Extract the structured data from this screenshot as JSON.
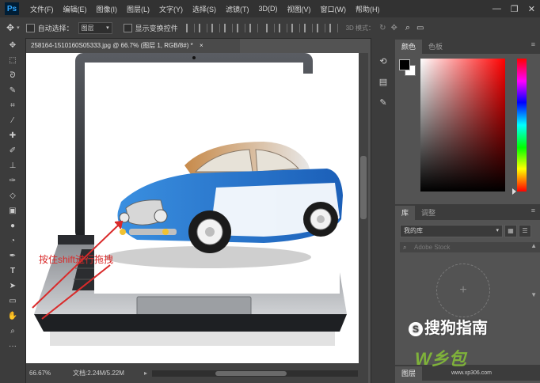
{
  "app": {
    "logo_text": "Ps",
    "menu": [
      "文件(F)",
      "编辑(E)",
      "图像(I)",
      "图层(L)",
      "文字(Y)",
      "选择(S)",
      "滤镜(T)",
      "3D(D)",
      "视图(V)",
      "窗口(W)",
      "帮助(H)"
    ],
    "window_controls": {
      "minimize": "—",
      "restore": "❐",
      "close": "✕"
    }
  },
  "options_bar": {
    "move_tool_icon": "move-icon",
    "auto_select_label": "自动选择：",
    "auto_select_checked": false,
    "auto_select_value": "图层",
    "show_transform_label": "显示变换控件",
    "show_transform_checked": false,
    "mode_3d_label": "3D 模式："
  },
  "tools": [
    "move-tool",
    "marquee-tool",
    "lasso-tool",
    "quick-select-tool",
    "crop-tool",
    "eyedropper-tool",
    "healing-brush-tool",
    "brush-tool",
    "clone-stamp-tool",
    "history-brush-tool",
    "eraser-tool",
    "gradient-tool",
    "blur-tool",
    "dodge-tool",
    "pen-tool",
    "type-tool",
    "path-select-tool",
    "rectangle-tool",
    "hand-tool",
    "zoom-tool"
  ],
  "document": {
    "tab_title": "258164-1510160S05333.jpg @ 66.7% (图层 1, RGB/8#) *",
    "tab_close": "×",
    "annotation_text": "按住shift进行拖拽",
    "zoom": "66.67%",
    "doc_size": "文档:2.24M/5.22M"
  },
  "panels": {
    "color": {
      "tabs": [
        "颜色",
        "色板"
      ],
      "active_tab": "颜色",
      "foreground": "#000000",
      "background": "#ffffff",
      "hue": "#ff0000"
    },
    "library": {
      "tabs": [
        "库",
        "调整"
      ],
      "active_tab": "库",
      "selected_library": "我的库",
      "search_placeholder": "Adobe Stock",
      "add_label": "+"
    },
    "layers": {
      "tabs": [
        "图层"
      ],
      "active_tab": "图层"
    }
  },
  "watermark": {
    "sogou_text": "搜狗指南",
    "sogou_symbol": "S",
    "site_logo": "W乡包",
    "site_url": "www.xp306.com"
  }
}
